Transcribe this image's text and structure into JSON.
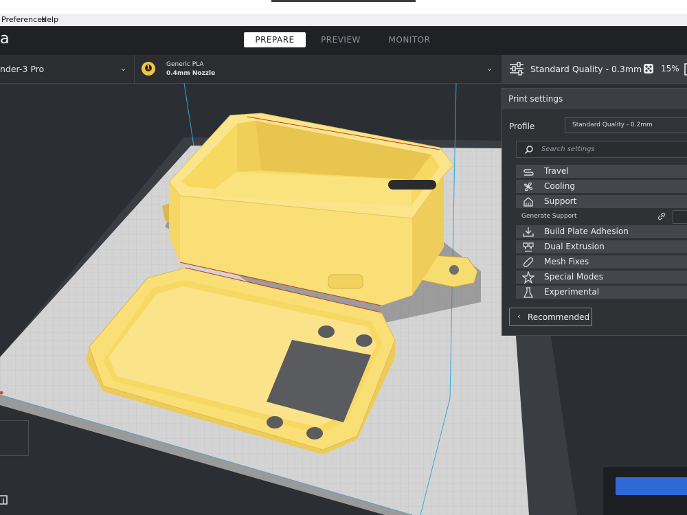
{
  "menu": {
    "preferences": "Preferences",
    "help": "Help"
  },
  "app": {
    "logo_fragment": "a"
  },
  "stages": {
    "prepare": "PREPARE",
    "preview": "PREVIEW",
    "monitor": "MONITOR"
  },
  "printer": {
    "name": "nder-3 Pro"
  },
  "extruder": {
    "number": "1",
    "material": "Generic PLA",
    "nozzle": "0.4mm Nozzle"
  },
  "quality_bar": {
    "quality": "Standard Quality - 0.3mm",
    "infill": "15%"
  },
  "print_settings": {
    "title": "Print settings",
    "profile_label": "Profile",
    "profile_value": "Standard Quality - 0.2mm",
    "search_placeholder": "Search settings",
    "categories": [
      {
        "label": "Travel",
        "icon": "travel-icon"
      },
      {
        "label": "Cooling",
        "icon": "fan-icon"
      },
      {
        "label": "Support",
        "icon": "support-icon"
      },
      {
        "label": "Build Plate Adhesion",
        "icon": "adhesion-icon"
      },
      {
        "label": "Dual Extrusion",
        "icon": "dual-extrusion-icon"
      },
      {
        "label": "Mesh Fixes",
        "icon": "mesh-fix-icon"
      },
      {
        "label": "Special Modes",
        "icon": "star-icon"
      },
      {
        "label": "Experimental",
        "icon": "flask-icon"
      }
    ],
    "generate_support_label": "Generate Support",
    "recommended_label": "Recommended"
  },
  "colors": {
    "model": "#f7dc6f",
    "model_shadow": "#d9b94a",
    "plate": "#cfcfcf",
    "accent_blue": "#2d6ad8",
    "background": "#2b2e33"
  }
}
